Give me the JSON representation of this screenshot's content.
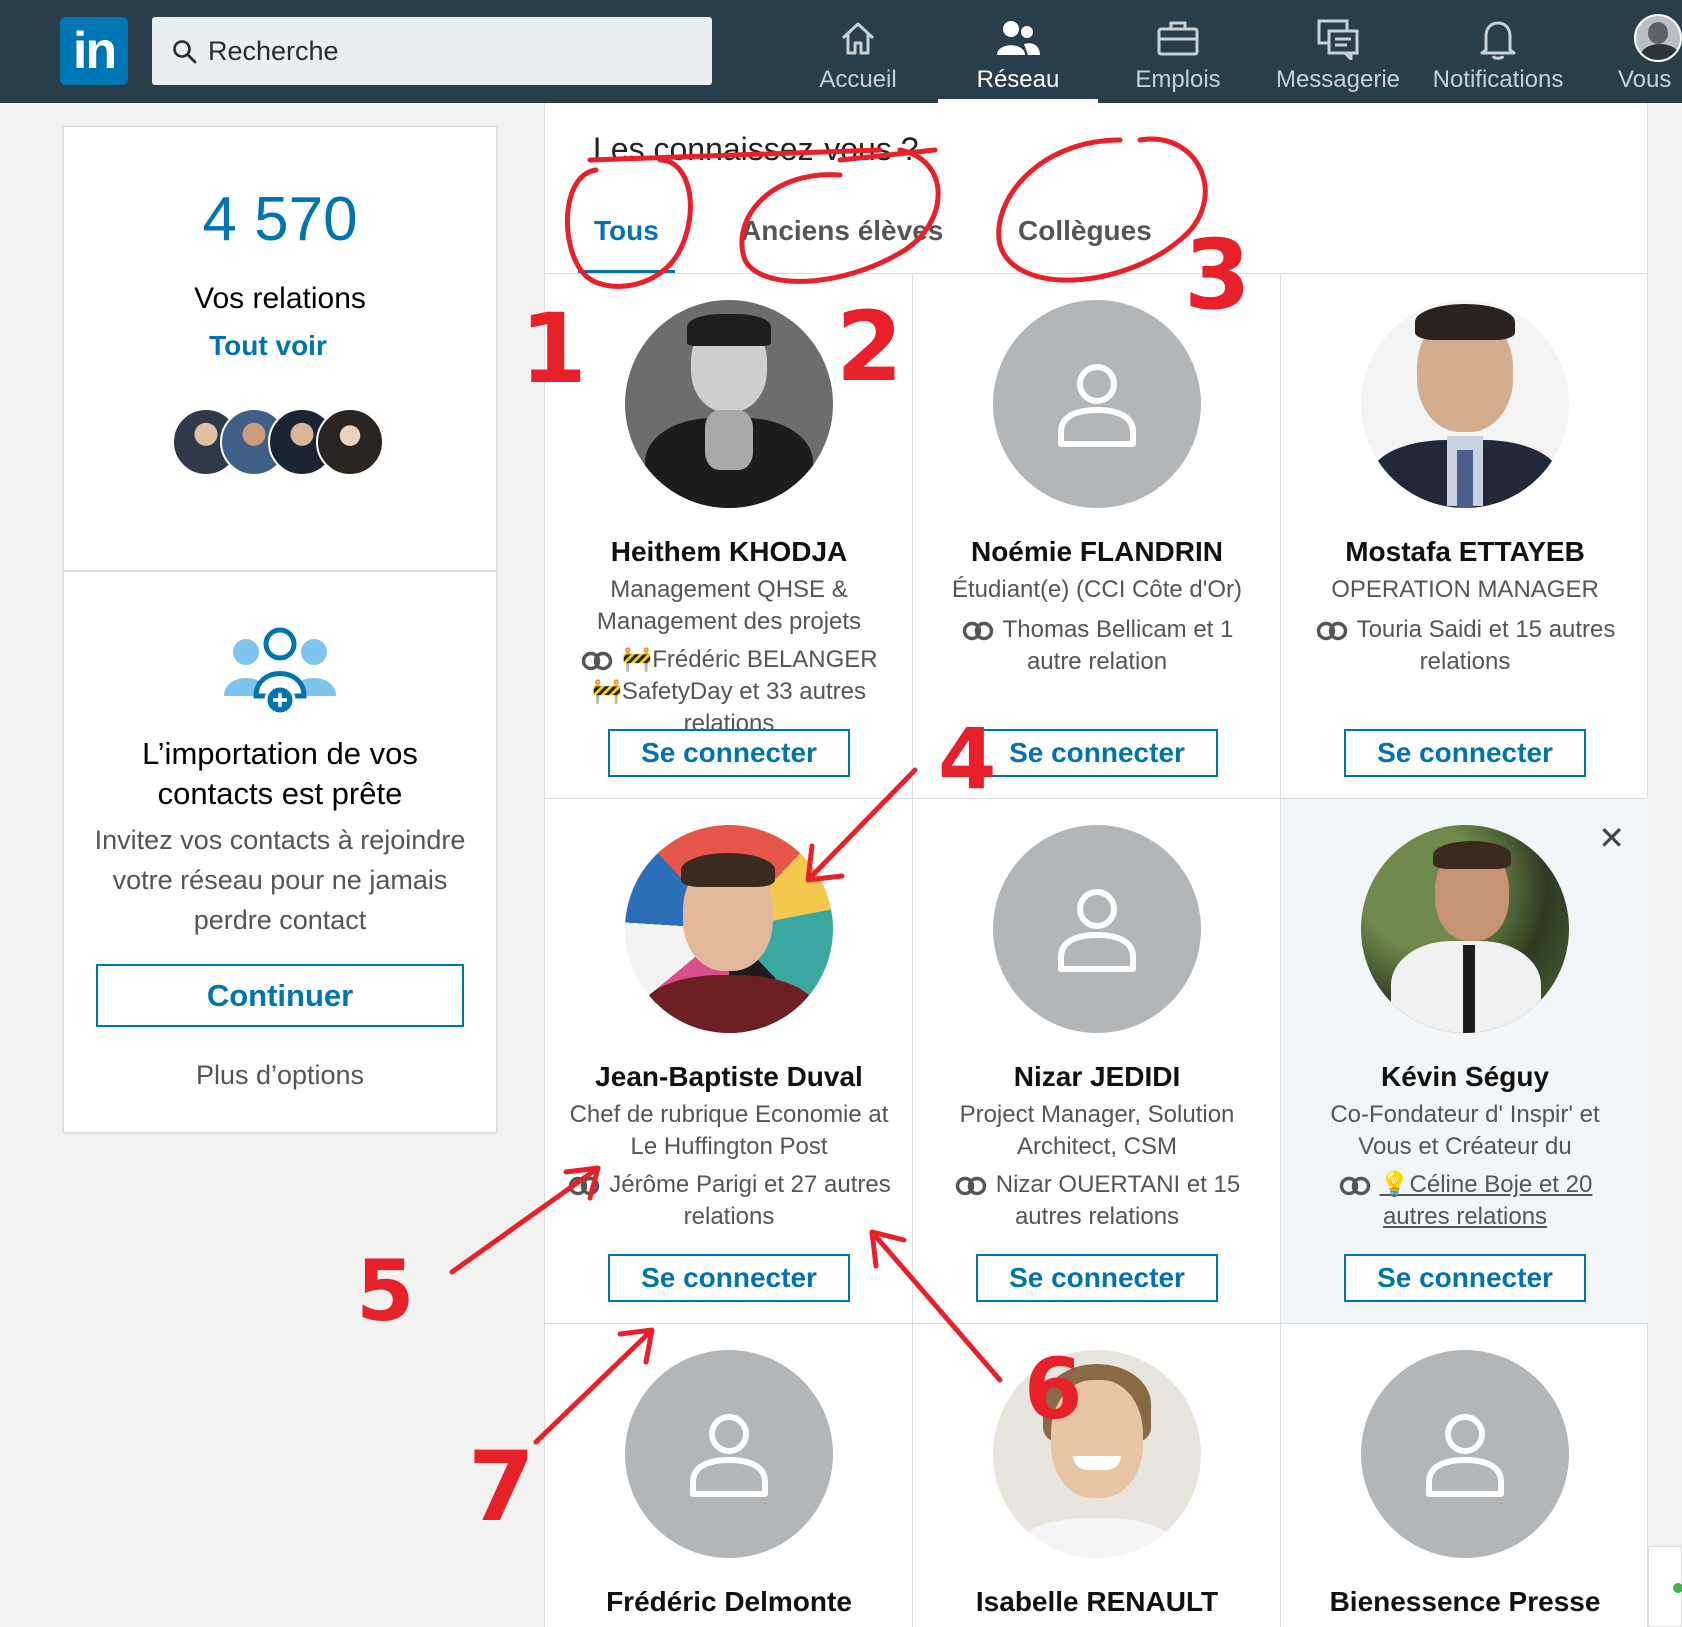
{
  "nav": {
    "logo": "in",
    "search_placeholder": "Recherche",
    "items": [
      {
        "label": "Accueil",
        "icon": "home-icon"
      },
      {
        "label": "Réseau",
        "icon": "network-icon",
        "active": true
      },
      {
        "label": "Emplois",
        "icon": "briefcase-icon"
      },
      {
        "label": "Messagerie",
        "icon": "messaging-icon"
      },
      {
        "label": "Notifications",
        "icon": "bell-icon"
      },
      {
        "label": "Vous",
        "icon": "avatar-icon"
      }
    ]
  },
  "relations": {
    "count": "4 570",
    "label": "Vos relations",
    "link": "Tout voir"
  },
  "import": {
    "title_line1": "L’importation de vos",
    "title_line2": "contacts est prête",
    "desc": "Invitez vos contacts à rejoindre votre réseau pour ne jamais perdre contact",
    "button": "Continuer",
    "more": "Plus d’options"
  },
  "suggestions": {
    "title": "Les connaissez-vous ?",
    "tabs": [
      "Tous",
      "Anciens élèves",
      "Collègues"
    ],
    "connect_label": "Se connecter",
    "people": [
      {
        "name": "Heithem KHODJA",
        "headline": "Management QHSE & Management des projets",
        "mutual": "🚧Frédéric BELANGER 🚧SafetyDay et 33 autres relations"
      },
      {
        "name": "Noémie FLANDRIN",
        "headline": "Étudiant(e) (CCI Côte d'Or)",
        "mutual": "Thomas Bellicam et 1 autre relation"
      },
      {
        "name": "Mostafa ETTAYEB",
        "headline": "OPERATION MANAGER",
        "mutual": "Touria Saidi et 15 autres relations"
      },
      {
        "name": "Jean-Baptiste Duval",
        "headline": "Chef de rubrique Economie at Le Huffington Post",
        "mutual": "Jérôme Parigi et 27 autres relations"
      },
      {
        "name": "Nizar JEDIDI",
        "headline": "Project Manager, Solution Architect, CSM",
        "mutual": "Nizar OUERTANI et 15 autres relations"
      },
      {
        "name": "Kévin Séguy",
        "headline": "Co-Fondateur d' Inspir' et Vous et Créateur du",
        "mutual": "💡Céline Boje et 20 autres relations"
      },
      {
        "name": "Frédéric Delmonte"
      },
      {
        "name": "Isabelle RENAULT"
      },
      {
        "name": "Bienessence Presse"
      }
    ]
  },
  "annotations": [
    "1",
    "2",
    "3",
    "4",
    "5",
    "6",
    "7"
  ],
  "colors": {
    "nav_bg": "#283e4a",
    "brand": "#0073b1",
    "annotation": "#e8202a"
  }
}
